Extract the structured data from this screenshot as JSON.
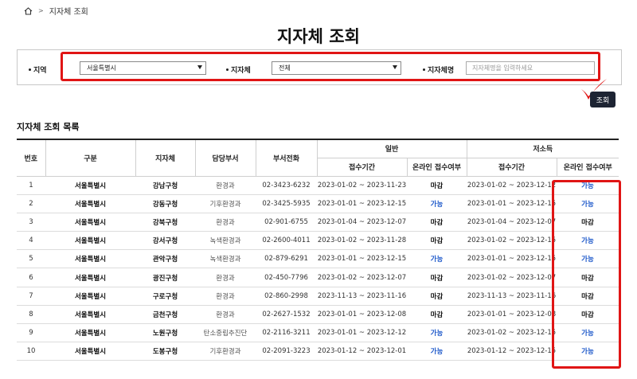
{
  "breadcrumb": {
    "current": "지자체 조회"
  },
  "page_title": "지자체 조회",
  "search": {
    "region_label": "지역",
    "region_value": "서울특별시",
    "localgov_label": "지자체",
    "localgov_value": "전체",
    "name_label": "지자체명",
    "name_placeholder": "지자체명을 입력하세요",
    "search_button": "조회"
  },
  "list": {
    "title": "지자체 조회 목록",
    "headers": {
      "no": "번호",
      "category": "구분",
      "localgov": "지자체",
      "dept": "담당부서",
      "phone": "부서전화",
      "general": "일반",
      "low_income": "저소득",
      "period": "접수기간",
      "online": "온라인 접수여부"
    },
    "rows": [
      {
        "no": "1",
        "category": "서울특별시",
        "localgov": "강남구청",
        "dept": "환경과",
        "phone": "02-3423-6232",
        "general_period": "2023-01-02 ~ 2023-11-23",
        "general_online": "마감",
        "low_period": "2023-01-02 ~ 2023-12-12",
        "low_online": "가능"
      },
      {
        "no": "2",
        "category": "서울특별시",
        "localgov": "강동구청",
        "dept": "기후환경과",
        "phone": "02-3425-5935",
        "general_period": "2023-01-01 ~ 2023-12-15",
        "general_online": "가능",
        "low_period": "2023-01-01 ~ 2023-12-15",
        "low_online": "가능"
      },
      {
        "no": "3",
        "category": "서울특별시",
        "localgov": "강북구청",
        "dept": "환경과",
        "phone": "02-901-6755",
        "general_period": "2023-01-04 ~ 2023-12-07",
        "general_online": "마감",
        "low_period": "2023-01-04 ~ 2023-12-07",
        "low_online": "마감"
      },
      {
        "no": "4",
        "category": "서울특별시",
        "localgov": "강서구청",
        "dept": "녹색환경과",
        "phone": "02-2600-4011",
        "general_period": "2023-01-02 ~ 2023-11-28",
        "general_online": "마감",
        "low_period": "2023-01-02 ~ 2023-12-15",
        "low_online": "가능"
      },
      {
        "no": "5",
        "category": "서울특별시",
        "localgov": "관악구청",
        "dept": "녹색환경과",
        "phone": "02-879-6291",
        "general_period": "2023-01-01 ~ 2023-12-15",
        "general_online": "가능",
        "low_period": "2023-01-01 ~ 2023-12-15",
        "low_online": "가능"
      },
      {
        "no": "6",
        "category": "서울특별시",
        "localgov": "광진구청",
        "dept": "환경과",
        "phone": "02-450-7796",
        "general_period": "2023-01-02 ~ 2023-12-07",
        "general_online": "마감",
        "low_period": "2023-01-02 ~ 2023-12-07",
        "low_online": "마감"
      },
      {
        "no": "7",
        "category": "서울특별시",
        "localgov": "구로구청",
        "dept": "환경과",
        "phone": "02-860-2998",
        "general_period": "2023-11-13 ~ 2023-11-16",
        "general_online": "마감",
        "low_period": "2023-11-13 ~ 2023-11-16",
        "low_online": "마감"
      },
      {
        "no": "8",
        "category": "서울특별시",
        "localgov": "금천구청",
        "dept": "환경과",
        "phone": "02-2627-1532",
        "general_period": "2023-01-01 ~ 2023-12-08",
        "general_online": "마감",
        "low_period": "2023-01-01 ~ 2023-12-08",
        "low_online": "마감"
      },
      {
        "no": "9",
        "category": "서울특별시",
        "localgov": "노원구청",
        "dept": "탄소중립추진단",
        "phone": "02-2116-3211",
        "general_period": "2023-01-01 ~ 2023-12-12",
        "general_online": "가능",
        "low_period": "2023-01-02 ~ 2023-12-15",
        "low_online": "가능"
      },
      {
        "no": "10",
        "category": "서울특별시",
        "localgov": "도봉구청",
        "dept": "기후환경과",
        "phone": "02-2091-3223",
        "general_period": "2023-01-12 ~ 2023-12-01",
        "general_online": "가능",
        "low_period": "2023-01-12 ~ 2023-12-15",
        "low_online": "가능"
      }
    ]
  },
  "colors": {
    "accent_red": "#e01515",
    "available_blue": "#1a56c9",
    "button_navy": "#1d2433"
  },
  "icons": {
    "home": "home-icon",
    "breadcrumb_separator": "chevron-right-icon",
    "annotation": "checkmark-icon"
  }
}
